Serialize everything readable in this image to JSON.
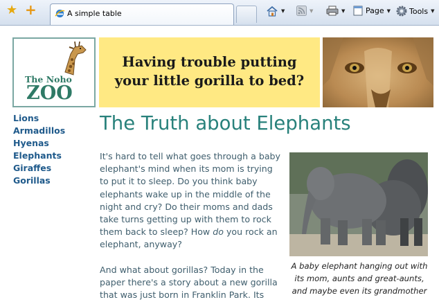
{
  "browser": {
    "tab_title": "A simple table",
    "tools": {
      "page_label": "Page",
      "tools_label": "Tools"
    }
  },
  "logo": {
    "line1": "The Noho",
    "line2": "ZOO"
  },
  "banner": {
    "line1": "Having trouble putting",
    "line2": "your little gorilla to bed?"
  },
  "nav": {
    "items": [
      "Lions",
      "Armadillos",
      "Hyenas",
      "Elephants",
      "Giraffes",
      "Gorillas"
    ]
  },
  "article": {
    "title": "The Truth about Elephants",
    "p1_before": "It's hard to tell what goes through a baby elephant's mind when its mom is trying to put it to sleep. Do you think baby elephants wake up in the middle of the night and cry? Do their moms and dads take turns getting up with them to rock them back to sleep? How ",
    "p1_em": "do",
    "p1_after": " you rock an elephant, anyway?",
    "p2": "And what about gorillas? Today in the paper there's a story about a new gorilla that was just born in Franklin Park. Its",
    "caption": "A baby elephant hanging out with its mom, aunts and great-aunts, and maybe even its grandmother"
  },
  "colors": {
    "accent": "#28817b",
    "nav_link": "#1f5a8b",
    "banner_bg": "#ffe983",
    "body_text": "#3f5e6d"
  }
}
